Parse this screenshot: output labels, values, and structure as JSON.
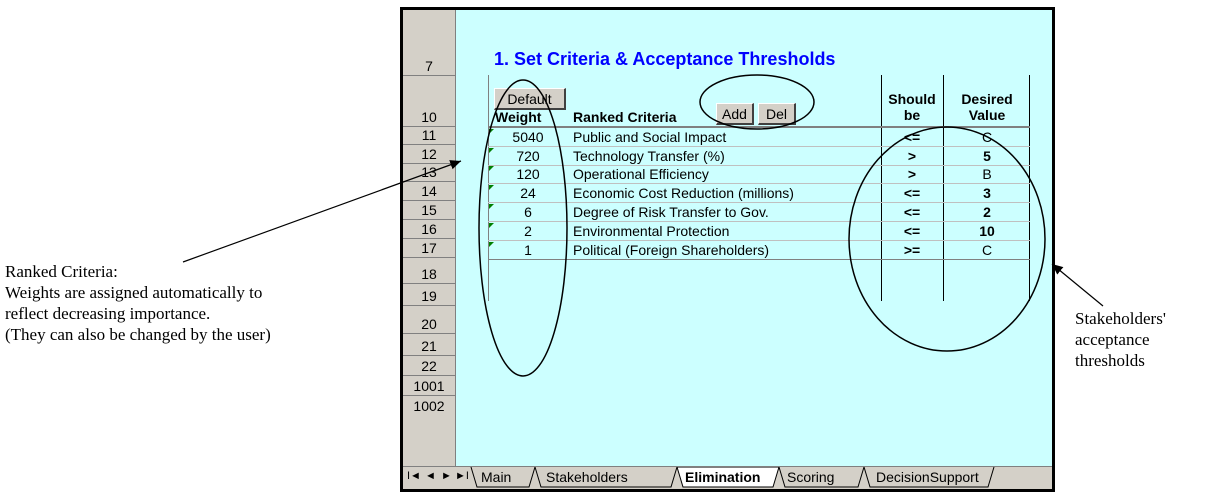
{
  "annotations": {
    "left": {
      "line1": "Ranked Criteria:",
      "line2": "Weights are assigned automatically to",
      "line3": "reflect decreasing importance.",
      "line4": "(They can also be changed by the user)"
    },
    "right": {
      "line1": "Stakeholders'",
      "line2": "acceptance",
      "line3": "thresholds"
    }
  },
  "sheet": {
    "title": "1. Set Criteria & Acceptance Thresholds",
    "row_headers": [
      "7",
      "10",
      "11",
      "12",
      "13",
      "14",
      "15",
      "16",
      "17",
      "18",
      "19",
      "20",
      "21",
      "22",
      "1001",
      "1002"
    ],
    "buttons": {
      "default": "Default",
      "add": "Add",
      "del": "Del"
    },
    "columns": {
      "weight": "Weight",
      "criteria": "Ranked Criteria",
      "should_line1": "Should",
      "should_line2": "be",
      "desired_line1": "Desired",
      "desired_line2": "Value"
    },
    "rows": [
      {
        "weight": "5040",
        "criteria": "Public and Social Impact",
        "op": "<=",
        "value": "C"
      },
      {
        "weight": "720",
        "criteria": "Technology Transfer (%)",
        "op": ">",
        "value": "5"
      },
      {
        "weight": "120",
        "criteria": "Operational Efficiency",
        "op": ">",
        "value": "B"
      },
      {
        "weight": "24",
        "criteria": "Economic Cost Reduction (millions)",
        "op": "<=",
        "value": "3"
      },
      {
        "weight": "6",
        "criteria": "Degree of Risk Transfer to Gov.",
        "op": "<=",
        "value": "2"
      },
      {
        "weight": "2",
        "criteria": "Environmental Protection",
        "op": "<=",
        "value": "10"
      },
      {
        "weight": "1",
        "criteria": "Political (Foreign Shareholders)",
        "op": ">=",
        "value": "C"
      }
    ],
    "nav": {
      "first": "I◄",
      "prev": "◄",
      "next": "►",
      "last": "►I"
    },
    "tabs": [
      "Main",
      "Stakeholders",
      "Elimination",
      "Scoring",
      "DecisionSupport"
    ],
    "active_tab": "Elimination"
  }
}
